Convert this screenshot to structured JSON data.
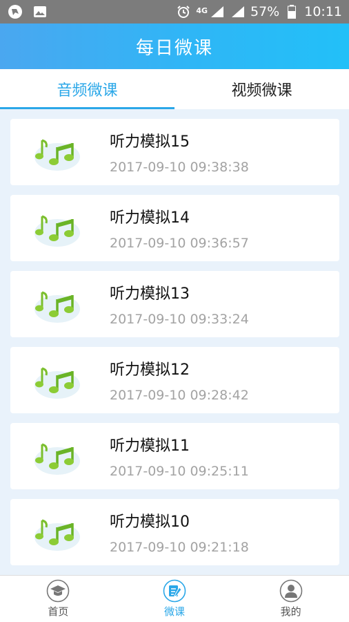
{
  "status_bar": {
    "network": "4G",
    "battery": "57%",
    "time": "10:11"
  },
  "header": {
    "title": "每日微课"
  },
  "tabs": [
    {
      "label": "音频微课",
      "active": true
    },
    {
      "label": "视频微课",
      "active": false
    }
  ],
  "items": [
    {
      "title": "听力模拟15",
      "date": "2017-09-10 09:38:38",
      "icon": "music-note-icon"
    },
    {
      "title": "听力模拟14",
      "date": "2017-09-10 09:36:57",
      "icon": "music-note-icon"
    },
    {
      "title": "听力模拟13",
      "date": "2017-09-10 09:33:24",
      "icon": "music-note-icon"
    },
    {
      "title": "听力模拟12",
      "date": "2017-09-10 09:28:42",
      "icon": "music-note-icon"
    },
    {
      "title": "听力模拟11",
      "date": "2017-09-10 09:25:11",
      "icon": "music-note-icon"
    },
    {
      "title": "听力模拟10",
      "date": "2017-09-10 09:21:18",
      "icon": "music-note-icon"
    }
  ],
  "bottom_nav": [
    {
      "label": "首页",
      "icon": "graduation-cap-icon",
      "active": false
    },
    {
      "label": "微课",
      "icon": "edit-note-icon",
      "active": true
    },
    {
      "label": "我的",
      "icon": "user-icon",
      "active": false
    }
  ],
  "colors": {
    "accent": "#2aa7e8",
    "header_start": "#4aa7f0",
    "header_end": "#22c0f8",
    "background": "#e9f2fb"
  }
}
